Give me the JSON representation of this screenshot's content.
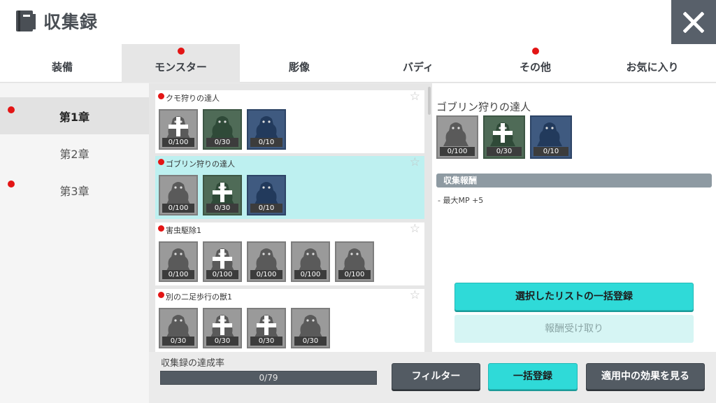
{
  "header": {
    "title": "収集録",
    "icon": "book-icon",
    "close_icon": "close-icon"
  },
  "tabs": [
    {
      "label": "装備",
      "dot": false,
      "active": false
    },
    {
      "label": "モンスター",
      "dot": true,
      "active": true
    },
    {
      "label": "彫像",
      "dot": false,
      "active": false
    },
    {
      "label": "バディ",
      "dot": false,
      "active": false
    },
    {
      "label": "その他",
      "dot": true,
      "active": false
    },
    {
      "label": "お気に入り",
      "dot": false,
      "active": false
    }
  ],
  "chapters": [
    {
      "label": "第1章",
      "dot": true,
      "active": true
    },
    {
      "label": "第2章",
      "dot": false,
      "active": false
    },
    {
      "label": "第3章",
      "dot": true,
      "active": false
    }
  ],
  "collections": [
    {
      "name": "クモ狩りの達人",
      "dot": true,
      "selected": false,
      "items": [
        {
          "count": "0/100",
          "plus": true,
          "color": "gray"
        },
        {
          "count": "0/30",
          "plus": false,
          "color": "green"
        },
        {
          "count": "0/10",
          "plus": false,
          "color": "blue"
        }
      ]
    },
    {
      "name": "ゴブリン狩りの達人",
      "dot": true,
      "selected": true,
      "items": [
        {
          "count": "0/100",
          "plus": false,
          "color": "gray"
        },
        {
          "count": "0/30",
          "plus": true,
          "color": "green"
        },
        {
          "count": "0/10",
          "plus": false,
          "color": "blue"
        }
      ]
    },
    {
      "name": "害虫駆除1",
      "dot": true,
      "selected": false,
      "items": [
        {
          "count": "0/100",
          "plus": false,
          "color": "gray"
        },
        {
          "count": "0/100",
          "plus": true,
          "color": "gray"
        },
        {
          "count": "0/100",
          "plus": false,
          "color": "gray"
        },
        {
          "count": "0/100",
          "plus": false,
          "color": "gray"
        },
        {
          "count": "0/100",
          "plus": false,
          "color": "gray"
        }
      ]
    },
    {
      "name": "別の二足歩行の獣1",
      "dot": true,
      "selected": false,
      "items": [
        {
          "count": "0/30",
          "plus": false,
          "color": "gray"
        },
        {
          "count": "0/30",
          "plus": true,
          "color": "gray"
        },
        {
          "count": "0/30",
          "plus": true,
          "color": "gray"
        },
        {
          "count": "0/30",
          "plus": false,
          "color": "gray"
        }
      ]
    }
  ],
  "detail": {
    "title": "ゴブリン狩りの達人",
    "items": [
      {
        "count": "0/100",
        "plus": false,
        "color": "gray"
      },
      {
        "count": "0/30",
        "plus": true,
        "color": "green"
      },
      {
        "count": "0/10",
        "plus": false,
        "color": "blue"
      }
    ],
    "rewards_header": "収集報酬",
    "reward_text": "- 最大MP +5",
    "bulk_select_label": "選択したリストの一括登録",
    "receive_label": "報酬受け取り"
  },
  "progress": {
    "label": "収集録の達成率",
    "text": "0/79",
    "fraction": 0
  },
  "buttons": {
    "filter": "フィルター",
    "bulk_register": "一括登録",
    "view_effects": "適用中の効果を見る"
  },
  "colors": {
    "accent": "#2fdad8",
    "dark_button": "#535b63",
    "notify_dot": "#e31515",
    "selected_card": "#bdf0f0"
  }
}
